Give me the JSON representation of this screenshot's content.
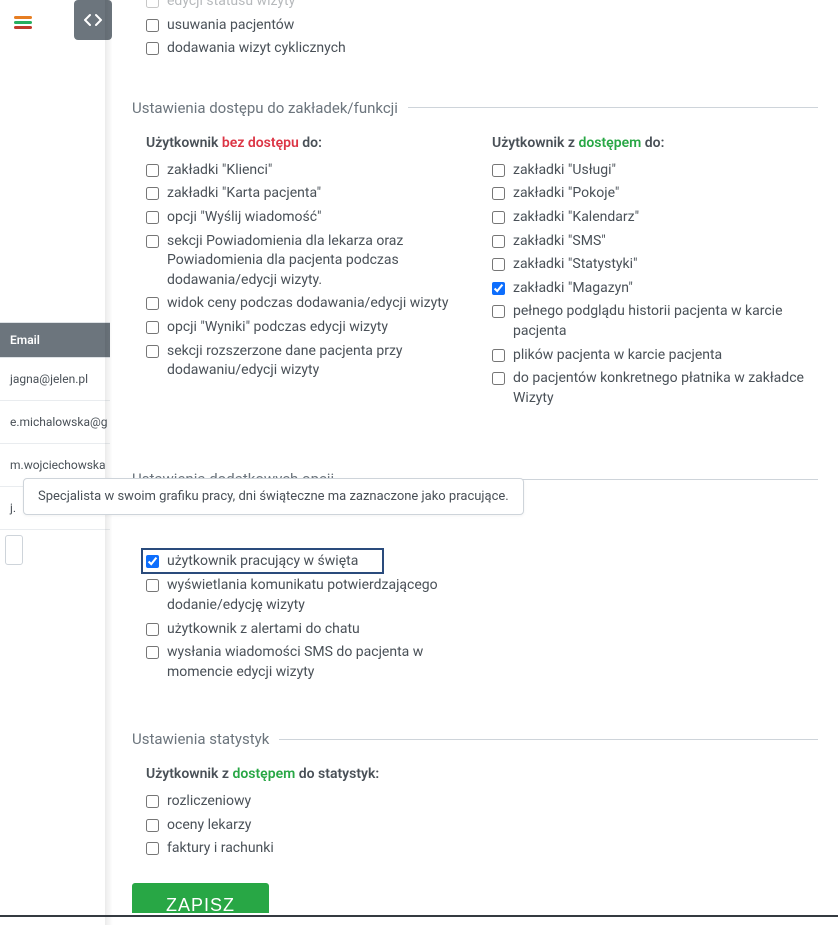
{
  "bg": {
    "header": "Email",
    "rows": [
      "jagna@jelen.pl",
      "e.michalowska@g",
      "m.wojciechowska",
      "j."
    ]
  },
  "top_section": {
    "items": [
      {
        "label": "edycji statusu wizyty",
        "checked": false
      },
      {
        "label": "usuwania pacjentów",
        "checked": false
      },
      {
        "label": "dodawania wizyt cyklicznych",
        "checked": false
      }
    ]
  },
  "access_section": {
    "title": "Ustawienia dostępu do zakładek/funkcji",
    "left_heading_prefix": "Użytkownik ",
    "left_heading_bold": "bez dostępu",
    "left_heading_suffix": " do:",
    "right_heading_prefix": "Użytkownik z ",
    "right_heading_bold": "dostępem",
    "right_heading_suffix": " do:",
    "left_items": [
      {
        "label": "zakładki \"Klienci\"",
        "checked": false
      },
      {
        "label": "zakładki \"Karta pacjenta\"",
        "checked": false
      },
      {
        "label": "opcji \"Wyślij wiadomość\"",
        "checked": false
      },
      {
        "label": "sekcji Powiadomienia dla lekarza oraz Powiadomienia dla pacjenta podczas dodawania/edycji wizyty.",
        "checked": false
      },
      {
        "label": "widok ceny podczas dodawania/edycji wizyty",
        "checked": false
      },
      {
        "label": "opcji \"Wyniki\" podczas edycji wizyty",
        "checked": false
      },
      {
        "label": "sekcji rozszerzone dane pacjenta przy dodawaniu/edycji wizyty",
        "checked": false
      }
    ],
    "right_items": [
      {
        "label": "zakładki \"Usługi\"",
        "checked": false
      },
      {
        "label": "zakładki \"Pokoje\"",
        "checked": false
      },
      {
        "label": "zakładki \"Kalendarz\"",
        "checked": false
      },
      {
        "label": "zakładki \"SMS\"",
        "checked": false
      },
      {
        "label": "zakładki \"Statystyki\"",
        "checked": false
      },
      {
        "label": "zakładki \"Magazyn\"",
        "checked": true
      },
      {
        "label": "pełnego podglądu historii pacjenta w karcie pacjenta",
        "checked": false
      },
      {
        "label": "plików pacjenta w karcie pacjenta",
        "checked": false
      },
      {
        "label": "do pacjentów konkretnego płatnika w zakładce Wizyty",
        "checked": false
      }
    ]
  },
  "extra_section": {
    "title": "Ustawienia dodatkowych opcji",
    "items": [
      {
        "label": "użytkownik pracujący w święta",
        "checked": true,
        "highlighted": true
      },
      {
        "label": "wyświetlania komunikatu potwierdzającego dodanie/edycję wizyty",
        "checked": false
      },
      {
        "label": "użytkownik z alertami do chatu",
        "checked": false
      },
      {
        "label": "wysłania wiadomości SMS do pacjenta w momencie edycji wizyty",
        "checked": false
      }
    ]
  },
  "tooltip": {
    "text": "Specjalista w swoim grafiku pracy, dni świąteczne ma zaznaczone jako pracujące."
  },
  "stats_section": {
    "title": "Ustawienia statystyk",
    "heading_prefix": "Użytkownik z ",
    "heading_bold": "dostępem",
    "heading_suffix": " do statystyk:",
    "items": [
      {
        "label": "rozliczeniowy",
        "checked": false
      },
      {
        "label": "oceny lekarzy",
        "checked": false
      },
      {
        "label": "faktury i rachunki",
        "checked": false
      }
    ]
  },
  "save_label": "ZAPISZ"
}
